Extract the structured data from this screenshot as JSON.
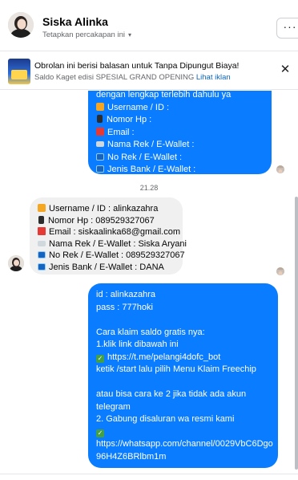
{
  "header": {
    "name": "Siska Alinka",
    "subtitle": "Tetapkan percakapan ini",
    "caret": "▾",
    "menu": "···"
  },
  "banner": {
    "title": "Obrolan ini berisi balasan untuk Tanpa Dipungut Biaya!",
    "subtitle": "Saldo Kaget edisi SPESIAL GRAND OPENING",
    "link": "Lihat iklan",
    "close": "✕"
  },
  "messages": {
    "first_out": {
      "lines": [
        "dengan lengkap terlebih dahulu ya",
        "Username / ID :",
        "Nomor Hp :",
        "Email :",
        "Nama Rek / E-Wallet :",
        "No Rek / E-Wallet :",
        "Jenis Bank / E-Wallet :"
      ]
    },
    "timestamp": "21.28",
    "reply_in": {
      "lines": [
        "Username / ID : alinkazahra",
        "Nomor Hp : 089529327067",
        "Email : siskaalinka68@gmail.com",
        "Nama Rek / E-Wallet : Siska Aryani",
        "No Rek / E-Wallet : 089529327067",
        "Jenis Bank / E-Wallet : DANA"
      ]
    },
    "second_out": {
      "id_line": "id : alinkazahra",
      "pass_line": "pass : 777hoki",
      "claim_title": "Cara klaim saldo gratis nya:",
      "step1": "1.klik link dibawah ini",
      "link1": "https://t.me/pelangi4dofc_bot",
      "step1b": "ketik /start lalu pilih Menu Klaim Freechip",
      "alt1": "atau bisa cara ke 2 jika tidak ada akun",
      "alt2": "telegram",
      "step2": "2. Gabung disaluran wa resmi kami",
      "link2a": "https://whatsapp.com/channel/0029VbC6Dgo",
      "link2b": "96H4Z6BRlbm1m"
    }
  }
}
